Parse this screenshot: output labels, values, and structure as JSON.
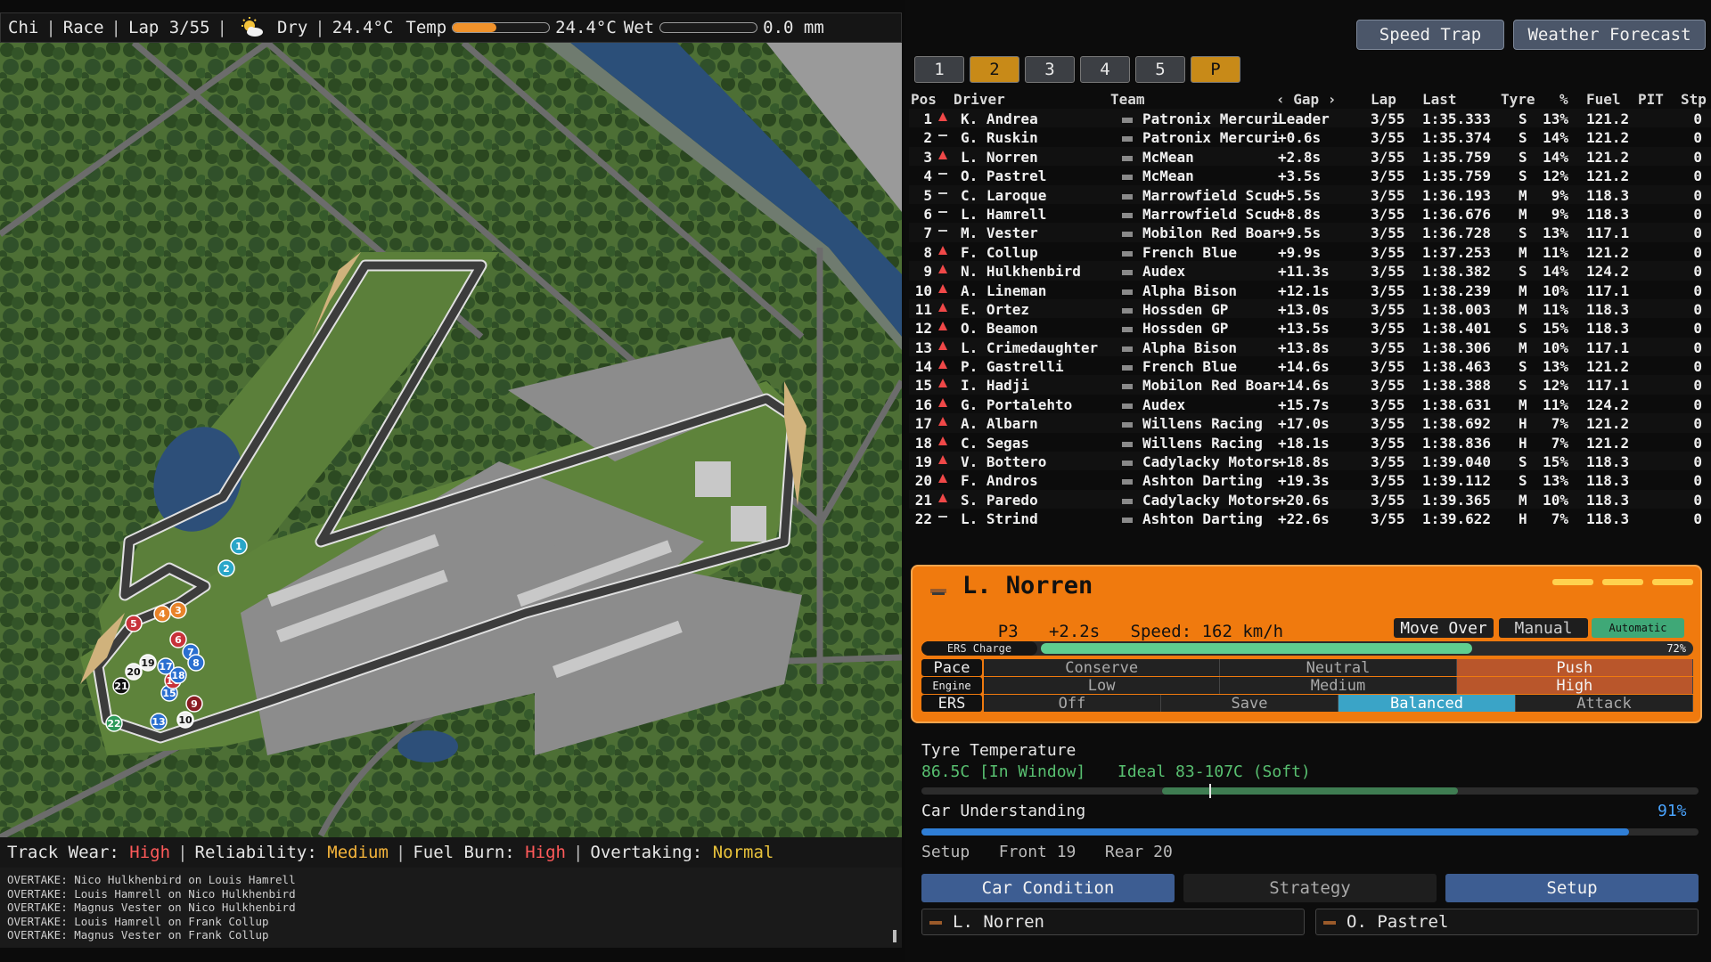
{
  "topbar": {
    "circuit": "Chi",
    "session": "Race",
    "lap": "Lap 3/55",
    "sep": "|",
    "condition": "Dry",
    "air_temp": "24.4°C",
    "temp_label": "Temp",
    "track_temp": "24.4°C",
    "wet_label": "Wet",
    "rain": "0.0 mm",
    "temp_level": 0.45,
    "wet_level": 0.0,
    "weather_icon": "sun-cloud-icon"
  },
  "map": {
    "markers": [
      {
        "n": "1",
        "color": "#29a6c8"
      },
      {
        "n": "2",
        "color": "#29a6c8"
      },
      {
        "n": "3",
        "color": "#e8832a"
      },
      {
        "n": "4",
        "color": "#e8832a"
      },
      {
        "n": "5",
        "color": "#c8323a"
      },
      {
        "n": "6",
        "color": "#c8323a"
      },
      {
        "n": "7",
        "color": "#2a6fd0"
      },
      {
        "n": "8",
        "color": "#2a6fd0"
      },
      {
        "n": "9",
        "color": "#8a1d24"
      },
      {
        "n": "10",
        "color": "#f0f0f0"
      },
      {
        "n": "13",
        "color": "#2a6fd0"
      },
      {
        "n": "15",
        "color": "#2a6fd0"
      },
      {
        "n": "16",
        "color": "#c8323a"
      },
      {
        "n": "17",
        "color": "#2a6fd0"
      },
      {
        "n": "18",
        "color": "#2a6fd0"
      },
      {
        "n": "19",
        "color": "#f0f0f0"
      },
      {
        "n": "20",
        "color": "#f0f0f0"
      },
      {
        "n": "21",
        "color": "#111111"
      },
      {
        "n": "22",
        "color": "#2e9a5a"
      }
    ]
  },
  "status": {
    "track_wear_label": "Track Wear:",
    "track_wear": "High",
    "reliability_label": "Reliability:",
    "reliability": "Medium",
    "fuel_burn_label": "Fuel Burn:",
    "fuel_burn": "High",
    "overtaking_label": "Overtaking:",
    "overtaking": "Normal"
  },
  "log": [
    "OVERTAKE: Nico Hulkhenbird on Louis Hamrell",
    "OVERTAKE: Louis Hamrell on Nico Hulkhenbird",
    "OVERTAKE: Magnus Vester on Nico Hulkhenbird",
    "OVERTAKE: Louis Hamrell on Frank Collup",
    "OVERTAKE: Magnus Vester on Frank Collup"
  ],
  "buttons": {
    "speed_trap": "Speed Trap",
    "weather_forecast": "Weather Forecast",
    "pages": [
      "1",
      "2",
      "3",
      "4",
      "5",
      "P"
    ]
  },
  "table": {
    "headers": {
      "pos": "Pos",
      "driver": "Driver",
      "team": "Team",
      "gap": "‹ Gap ›",
      "lap": "Lap",
      "last": "Last",
      "tyre": "Tyre",
      "pct": "%",
      "fuel": "Fuel",
      "pit": "PIT",
      "stp": "Stp"
    },
    "rows": [
      {
        "pos": "1",
        "trend": "up",
        "driver": "K. Andrea",
        "team": "Patronix Mercuri",
        "gap": "Leader",
        "lap": "3/55",
        "last": "1:35.333",
        "tyre": "S",
        "pct": "13%",
        "fuel": "121.2",
        "stp": "0"
      },
      {
        "pos": "2",
        "trend": "flat",
        "driver": "G. Ruskin",
        "team": "Patronix Mercuri",
        "gap": "+0.6s",
        "lap": "3/55",
        "last": "1:35.374",
        "tyre": "S",
        "pct": "14%",
        "fuel": "121.2",
        "stp": "0"
      },
      {
        "pos": "3",
        "trend": "up",
        "driver": "L. Norren",
        "team": "McMean",
        "gap": "+2.8s",
        "lap": "3/55",
        "last": "1:35.759",
        "tyre": "S",
        "pct": "14%",
        "fuel": "121.2",
        "stp": "0"
      },
      {
        "pos": "4",
        "trend": "flat",
        "driver": "O. Pastrel",
        "team": "McMean",
        "gap": "+3.5s",
        "lap": "3/55",
        "last": "1:35.759",
        "tyre": "S",
        "pct": "12%",
        "fuel": "121.2",
        "stp": "0"
      },
      {
        "pos": "5",
        "trend": "flat",
        "driver": "C. Laroque",
        "team": "Marrowfield Scud",
        "gap": "+5.5s",
        "lap": "3/55",
        "last": "1:36.193",
        "tyre": "M",
        "pct": "9%",
        "fuel": "118.3",
        "stp": "0"
      },
      {
        "pos": "6",
        "trend": "flat",
        "driver": "L. Hamrell",
        "team": "Marrowfield Scud",
        "gap": "+8.8s",
        "lap": "3/55",
        "last": "1:36.676",
        "tyre": "M",
        "pct": "9%",
        "fuel": "118.3",
        "stp": "0"
      },
      {
        "pos": "7",
        "trend": "flat",
        "driver": "M. Vester",
        "team": "Mobilon Red Boar",
        "gap": "+9.5s",
        "lap": "3/55",
        "last": "1:36.728",
        "tyre": "S",
        "pct": "13%",
        "fuel": "117.1",
        "stp": "0"
      },
      {
        "pos": "8",
        "trend": "up",
        "driver": "F. Collup",
        "team": "French Blue",
        "gap": "+9.9s",
        "lap": "3/55",
        "last": "1:37.253",
        "tyre": "M",
        "pct": "11%",
        "fuel": "121.2",
        "stp": "0"
      },
      {
        "pos": "9",
        "trend": "up",
        "driver": "N. Hulkhenbird",
        "team": "Audex",
        "gap": "+11.3s",
        "lap": "3/55",
        "last": "1:38.382",
        "tyre": "S",
        "pct": "14%",
        "fuel": "124.2",
        "stp": "0"
      },
      {
        "pos": "10",
        "trend": "up",
        "driver": "A. Lineman",
        "team": "Alpha Bison",
        "gap": "+12.1s",
        "lap": "3/55",
        "last": "1:38.239",
        "tyre": "M",
        "pct": "10%",
        "fuel": "117.1",
        "stp": "0"
      },
      {
        "pos": "11",
        "trend": "up",
        "driver": "E. Ortez",
        "team": "Hossden GP",
        "gap": "+13.0s",
        "lap": "3/55",
        "last": "1:38.003",
        "tyre": "M",
        "pct": "11%",
        "fuel": "118.3",
        "stp": "0"
      },
      {
        "pos": "12",
        "trend": "up",
        "driver": "O. Beamon",
        "team": "Hossden GP",
        "gap": "+13.5s",
        "lap": "3/55",
        "last": "1:38.401",
        "tyre": "S",
        "pct": "15%",
        "fuel": "118.3",
        "stp": "0"
      },
      {
        "pos": "13",
        "trend": "up",
        "driver": "L. Crimedaughter",
        "team": "Alpha Bison",
        "gap": "+13.8s",
        "lap": "3/55",
        "last": "1:38.306",
        "tyre": "M",
        "pct": "10%",
        "fuel": "117.1",
        "stp": "0"
      },
      {
        "pos": "14",
        "trend": "up",
        "driver": "P. Gastrelli",
        "team": "French Blue",
        "gap": "+14.6s",
        "lap": "3/55",
        "last": "1:38.463",
        "tyre": "S",
        "pct": "13%",
        "fuel": "121.2",
        "stp": "0"
      },
      {
        "pos": "15",
        "trend": "up",
        "driver": "I. Hadji",
        "team": "Mobilon Red Boar",
        "gap": "+14.6s",
        "lap": "3/55",
        "last": "1:38.388",
        "tyre": "S",
        "pct": "12%",
        "fuel": "117.1",
        "stp": "0"
      },
      {
        "pos": "16",
        "trend": "up",
        "driver": "G. Portalehto",
        "team": "Audex",
        "gap": "+15.7s",
        "lap": "3/55",
        "last": "1:38.631",
        "tyre": "M",
        "pct": "11%",
        "fuel": "124.2",
        "stp": "0"
      },
      {
        "pos": "17",
        "trend": "up",
        "driver": "A. Albarn",
        "team": "Willens Racing",
        "gap": "+17.0s",
        "lap": "3/55",
        "last": "1:38.692",
        "tyre": "H",
        "pct": "7%",
        "fuel": "121.2",
        "stp": "0"
      },
      {
        "pos": "18",
        "trend": "up",
        "driver": "C. Segas",
        "team": "Willens Racing",
        "gap": "+18.1s",
        "lap": "3/55",
        "last": "1:38.836",
        "tyre": "H",
        "pct": "7%",
        "fuel": "121.2",
        "stp": "0"
      },
      {
        "pos": "19",
        "trend": "up",
        "driver": "V. Bottero",
        "team": "Cadylacky Motors",
        "gap": "+18.8s",
        "lap": "3/55",
        "last": "1:39.040",
        "tyre": "S",
        "pct": "15%",
        "fuel": "118.3",
        "stp": "0"
      },
      {
        "pos": "20",
        "trend": "up",
        "driver": "F. Andros",
        "team": "Ashton Darting",
        "gap": "+19.3s",
        "lap": "3/55",
        "last": "1:39.112",
        "tyre": "S",
        "pct": "13%",
        "fuel": "118.3",
        "stp": "0"
      },
      {
        "pos": "21",
        "trend": "up",
        "driver": "S. Paredo",
        "team": "Cadylacky Motors",
        "gap": "+20.6s",
        "lap": "3/55",
        "last": "1:39.365",
        "tyre": "M",
        "pct": "10%",
        "fuel": "118.3",
        "stp": "0"
      },
      {
        "pos": "22",
        "trend": "flat",
        "driver": "L. Strind",
        "team": "Ashton Darting",
        "gap": "+22.6s",
        "lap": "3/55",
        "last": "1:39.622",
        "tyre": "H",
        "pct": "7%",
        "fuel": "118.3",
        "stp": "0"
      }
    ]
  },
  "driver_panel": {
    "name": "L. Norren",
    "position": "P3",
    "gap": "+2.2s",
    "speed": "Speed: 162 km/h",
    "move_over": "Move Over",
    "manual": "Manual",
    "automatic": "Automatic",
    "ers_label": "ERS Charge",
    "ers_value": "72%",
    "ers_level": 0.72,
    "pace_label": "Pace",
    "pace_options": [
      "Conserve",
      "Neutral",
      "Push"
    ],
    "engine_label": "Engine",
    "engine_options": [
      "Low",
      "Medium",
      "High"
    ],
    "ers_mode_label": "ERS",
    "ers_options": [
      "Off",
      "Save",
      "Balanced",
      "Attack"
    ]
  },
  "tyre": {
    "title": "Tyre Temperature",
    "value": "86.5C [In Window]",
    "ideal": "Ideal 83-107C (Soft)",
    "current_level": 0.37,
    "window_start": 0.31,
    "window_end": 0.69
  },
  "understanding": {
    "title": "Car Understanding",
    "value": "91%",
    "level": 0.91
  },
  "setup": {
    "label": "Setup",
    "front": "Front 19",
    "rear": "Rear 20"
  },
  "bottom_tabs": [
    "Car Condition",
    "Strategy",
    "Setup"
  ],
  "selectors": {
    "left": "L. Norren",
    "right": "O. Pastrel"
  }
}
